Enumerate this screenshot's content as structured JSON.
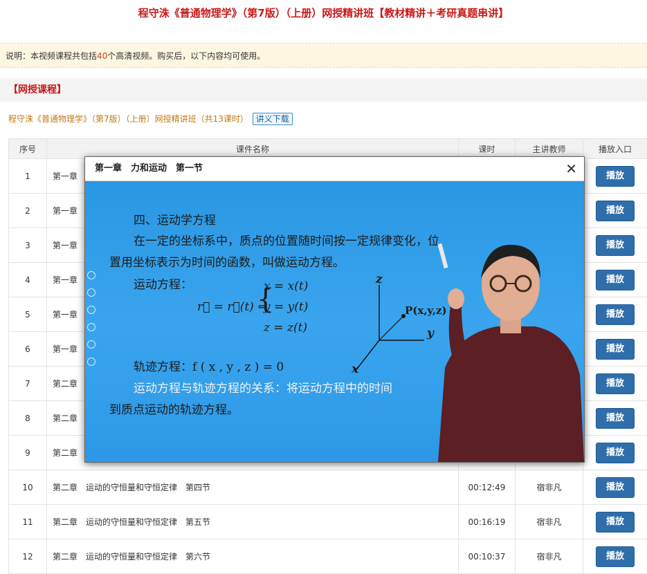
{
  "header": {
    "title": "程守洙《普通物理学》（第7版）（上册）网授精讲班【教材精讲＋考研真题串讲】"
  },
  "notice": {
    "prefix": "说明：本视频课程共包括",
    "count": "40",
    "suffix": "个高清视频。购买后，以下内容均可使用。"
  },
  "section": {
    "title": "【网授课程】"
  },
  "course": {
    "title": "程守洙《普通物理学》（第7版）（上册）网授精讲班（共13课时）",
    "handout_label": "讲义下载"
  },
  "table": {
    "headers": {
      "index": "序号",
      "name": "课件名称",
      "duration": "课时",
      "teacher": "主讲教师",
      "play": "播放入口"
    },
    "rows": [
      {
        "index": "1",
        "name": "第一章",
        "duration": "",
        "teacher": "",
        "play": "播放"
      },
      {
        "index": "2",
        "name": "第一章",
        "duration": "",
        "teacher": "",
        "play": "播放"
      },
      {
        "index": "3",
        "name": "第一章",
        "duration": "",
        "teacher": "",
        "play": "播放"
      },
      {
        "index": "4",
        "name": "第一章",
        "duration": "",
        "teacher": "",
        "play": "播放"
      },
      {
        "index": "5",
        "name": "第一章",
        "duration": "",
        "teacher": "",
        "play": "播放"
      },
      {
        "index": "6",
        "name": "第一章",
        "duration": "",
        "teacher": "",
        "play": "播放"
      },
      {
        "index": "7",
        "name": "第二章",
        "duration": "",
        "teacher": "",
        "play": "播放"
      },
      {
        "index": "8",
        "name": "第二章",
        "duration": "",
        "teacher": "",
        "play": "播放"
      },
      {
        "index": "9",
        "name": "第二章",
        "duration": "",
        "teacher": "",
        "play": "播放"
      },
      {
        "index": "10",
        "name": "第二章　运动的守恒量和守恒定律　第四节",
        "duration": "00:12:49",
        "teacher": "宿非凡",
        "play": "播放"
      },
      {
        "index": "11",
        "name": "第二章　运动的守恒量和守恒定律　第五节",
        "duration": "00:16:19",
        "teacher": "宿非凡",
        "play": "播放"
      },
      {
        "index": "12",
        "name": "第二章　运动的守恒量和守恒定律　第六节",
        "duration": "00:10:37",
        "teacher": "宿非凡",
        "play": "播放"
      }
    ]
  },
  "modal": {
    "title": "第一章　力和运动　第一节",
    "close_icon": "close-icon",
    "video": {
      "heading": "四、运动学方程",
      "line1": "在一定的坐标系中，质点的位置随时间按一定规律变化，位",
      "line2": "置用坐标表示为时间的函数，叫做运动方程。",
      "label_motion": "运动方程：",
      "eq_lhs": "r⃗ = r⃗(t) ⇔",
      "eq1": "x = x(t)",
      "eq2": "y = y(t)",
      "eq3": "z = z(t)",
      "trajectory": "轨迹方程：f ( x , y , z ) = 0",
      "relation": "运动方程与轨迹方程的关系：将运动方程中的时间",
      "line_last": "到质点运动的轨迹方程。",
      "axis_z": "z",
      "axis_y": "y",
      "axis_x": "x",
      "point_label": "P(x,y,z)"
    }
  },
  "colors": {
    "title_red": "#c81919",
    "play_blue": "#2f6eab",
    "video_blue": "#2a97e3"
  }
}
